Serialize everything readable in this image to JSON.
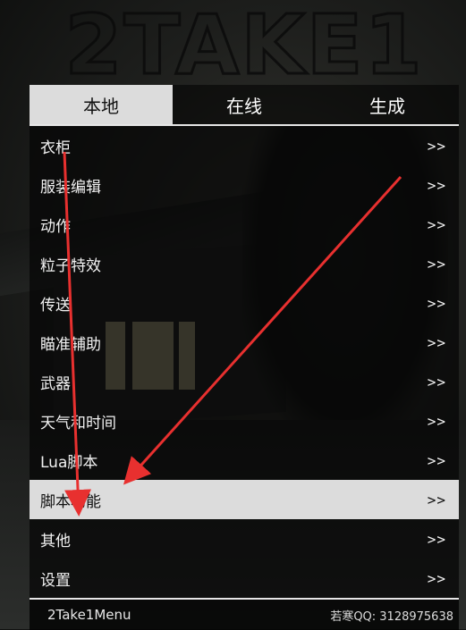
{
  "logo": {
    "text": "2TAKE1"
  },
  "tabs": [
    {
      "label": "本地",
      "active": true
    },
    {
      "label": "在线",
      "active": false
    },
    {
      "label": "生成",
      "active": false
    }
  ],
  "items": [
    {
      "label": "衣柜",
      "arrow": ">>"
    },
    {
      "label": "服装编辑",
      "arrow": ">>"
    },
    {
      "label": "动作",
      "arrow": ">>"
    },
    {
      "label": "粒子特效",
      "arrow": ">>"
    },
    {
      "label": "传送",
      "arrow": ">>"
    },
    {
      "label": "瞄准辅助",
      "arrow": ">>"
    },
    {
      "label": "武器",
      "arrow": ">>"
    },
    {
      "label": "天气和时间",
      "arrow": ">>"
    },
    {
      "label": "Lua脚本",
      "arrow": ">>"
    },
    {
      "label": "脚本功能",
      "arrow": ">>",
      "selected": true
    },
    {
      "label": "其他",
      "arrow": ">>"
    },
    {
      "label": "设置",
      "arrow": ">>"
    }
  ],
  "footer": {
    "name": "2Take1Menu",
    "qq": "若寒QQ: 3128975638"
  },
  "colors": {
    "annotation": "#e8302f",
    "selected_bg": "#dcdcdc"
  }
}
